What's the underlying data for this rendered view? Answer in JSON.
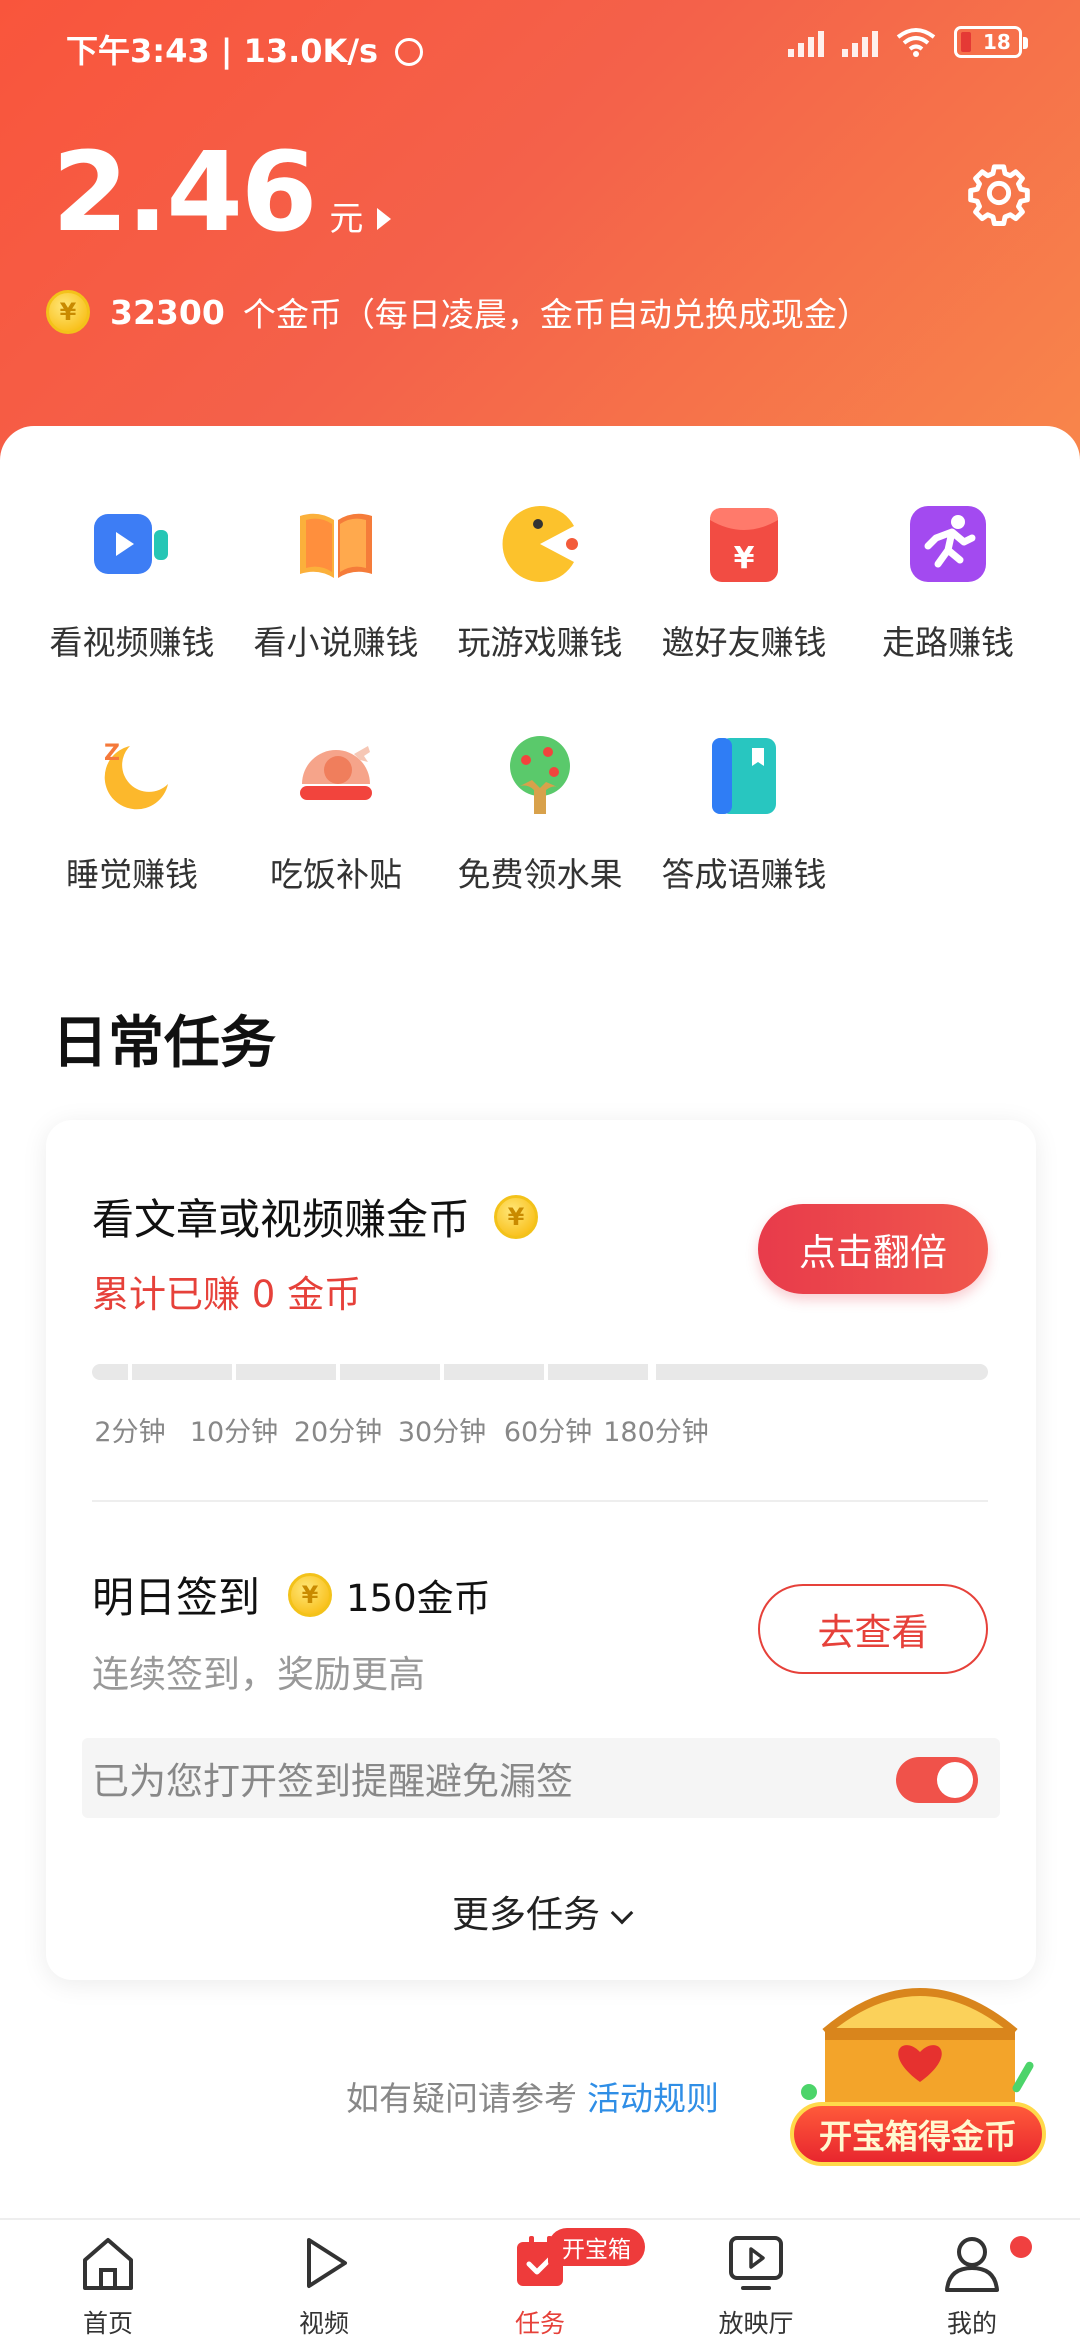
{
  "status_bar": {
    "time": "下午3:43",
    "speed": "13.0K/s",
    "battery": "18"
  },
  "header": {
    "balance": "2.46",
    "unit": "元",
    "coins": "32300",
    "coins_text": "个金币（每日凌晨，金币自动兑换成现金）"
  },
  "features": [
    {
      "label": "看视频赚钱",
      "icon": "video-icon"
    },
    {
      "label": "看小说赚钱",
      "icon": "book-icon"
    },
    {
      "label": "玩游戏赚钱",
      "icon": "pacman-game-icon"
    },
    {
      "label": "邀好友赚钱",
      "icon": "red-envelope-icon"
    },
    {
      "label": "走路赚钱",
      "icon": "running-icon"
    },
    {
      "label": "睡觉赚钱",
      "icon": "moon-sleep-icon"
    },
    {
      "label": "吃饭补贴",
      "icon": "chicken-leg-icon"
    },
    {
      "label": "免费领水果",
      "icon": "fruit-tree-icon"
    },
    {
      "label": "答成语赚钱",
      "icon": "idiom-book-icon"
    }
  ],
  "daily_tasks": {
    "title": "日常任务",
    "task1": {
      "title": "看文章或视频赚金币",
      "earned": "累计已赚 0 金币",
      "button": "点击翻倍",
      "progress": 0,
      "ticks": [
        "2分钟",
        "10分钟",
        "20分钟",
        "30分钟",
        "60分钟",
        "180分钟"
      ]
    },
    "task2": {
      "title": "明日签到",
      "reward": "150金币",
      "subtitle": "连续签到，奖励更高",
      "button": "去查看",
      "reminder": "已为您打开签到提醒避免漏签",
      "reminder_on": true
    },
    "more": "更多任务"
  },
  "help": {
    "text": "如有疑问请参考",
    "link": "活动规则"
  },
  "chest": {
    "label": "开宝箱得金币"
  },
  "nav": {
    "items": [
      {
        "label": "首页",
        "icon": "home-icon"
      },
      {
        "label": "视频",
        "icon": "play-icon"
      },
      {
        "label": "任务",
        "icon": "task-icon",
        "active": true
      },
      {
        "label": "放映厅",
        "icon": "screen-icon"
      },
      {
        "label": "我的",
        "icon": "profile-icon"
      }
    ],
    "task_badge": "开宝箱"
  },
  "colors": {
    "accent": "#e6413a",
    "header_start": "#f9553c",
    "header_end": "#f8864b",
    "link": "#2f8ee6"
  }
}
